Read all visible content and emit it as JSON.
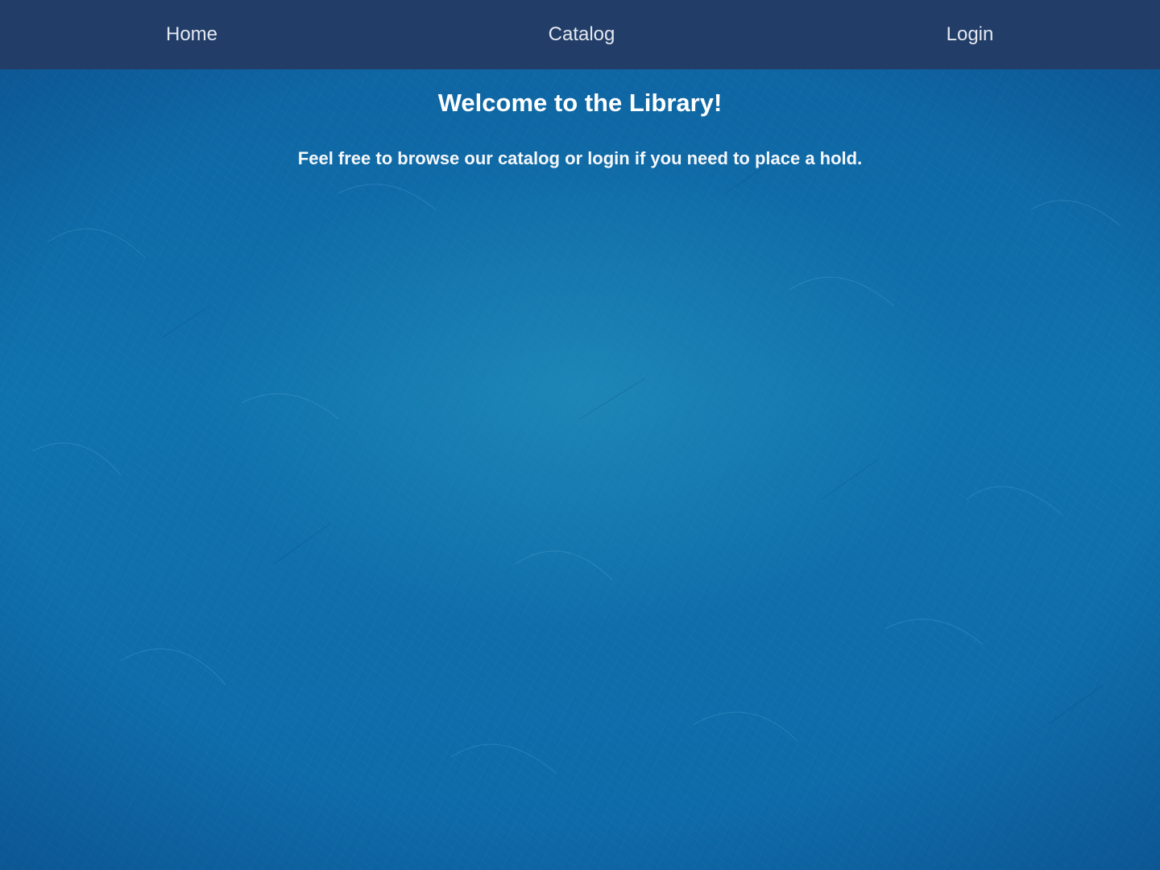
{
  "nav": {
    "home_label": "Home",
    "catalog_label": "Catalog",
    "login_label": "Login"
  },
  "main": {
    "title": "Welcome to the Library!",
    "subtitle": "Feel free to browse our catalog or login if you need to place a hold."
  },
  "colors": {
    "navbar_background": "#223d68",
    "page_background": "#0f6aa6",
    "text": "#ffffff"
  }
}
